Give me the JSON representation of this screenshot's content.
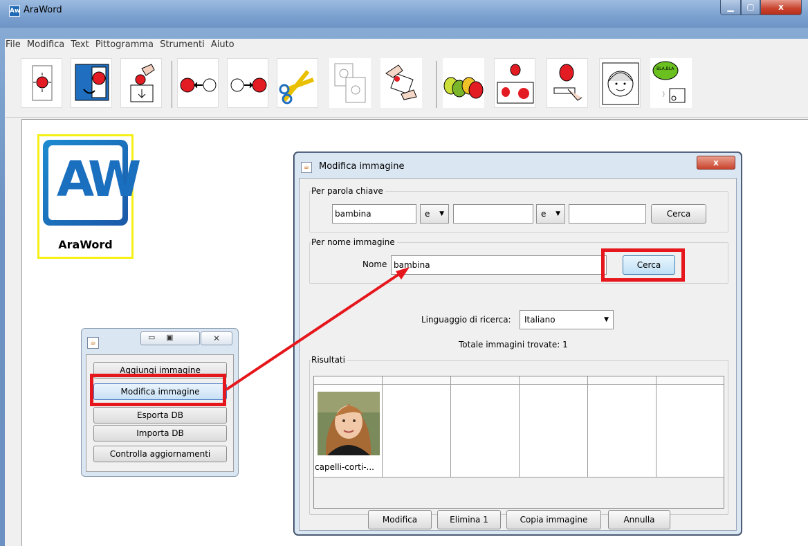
{
  "window": {
    "title": "AraWord",
    "app_icon": "Aw"
  },
  "menu": [
    "File",
    "Modifica",
    "Text",
    "Pittogramma",
    "Strumenti",
    "Aiuto"
  ],
  "toolbar_icons": [
    "new-document-icon",
    "open-door-icon",
    "save-box-icon",
    "previous-arrow-icon",
    "next-arrow-icon",
    "scissors-icon",
    "copy-pages-icon",
    "paste-hands-icon",
    "apples-icon",
    "apple-resize-icon",
    "apple-edit-icon",
    "face-icon",
    "speech-icon"
  ],
  "document_icon": {
    "logo_text": "AW",
    "label": "AraWord"
  },
  "small_window": {
    "buttons": [
      "Aggiungi immagine",
      "Modifica immagine",
      "Esporta DB",
      "Importa DB",
      "Controlla aggiornamenti"
    ]
  },
  "dialog": {
    "title": "Modifica immagine",
    "keyword_group": {
      "label": "Per parola chiave",
      "field1": "bambina",
      "op1": "e",
      "field2": "",
      "op2": "e",
      "field3": "",
      "search": "Cerca"
    },
    "name_group": {
      "label": "Per nome immagine",
      "name_label": "Nome",
      "name_value": "bambina",
      "search": "Cerca"
    },
    "language_label": "Linguaggio di ricerca:",
    "language_value": "Italiano",
    "total_found": "Totale immagini trovate: 1",
    "results_label": "Risultati",
    "result_caption": "capelli-corti-...",
    "buttons": {
      "edit": "Modifica",
      "delete": "Elimina 1",
      "copy": "Copia immagine",
      "cancel": "Annulla"
    }
  },
  "colors": {
    "highlight": "#e5171c",
    "icon_border": "#f7f015",
    "brand": "#1a6fbf"
  }
}
